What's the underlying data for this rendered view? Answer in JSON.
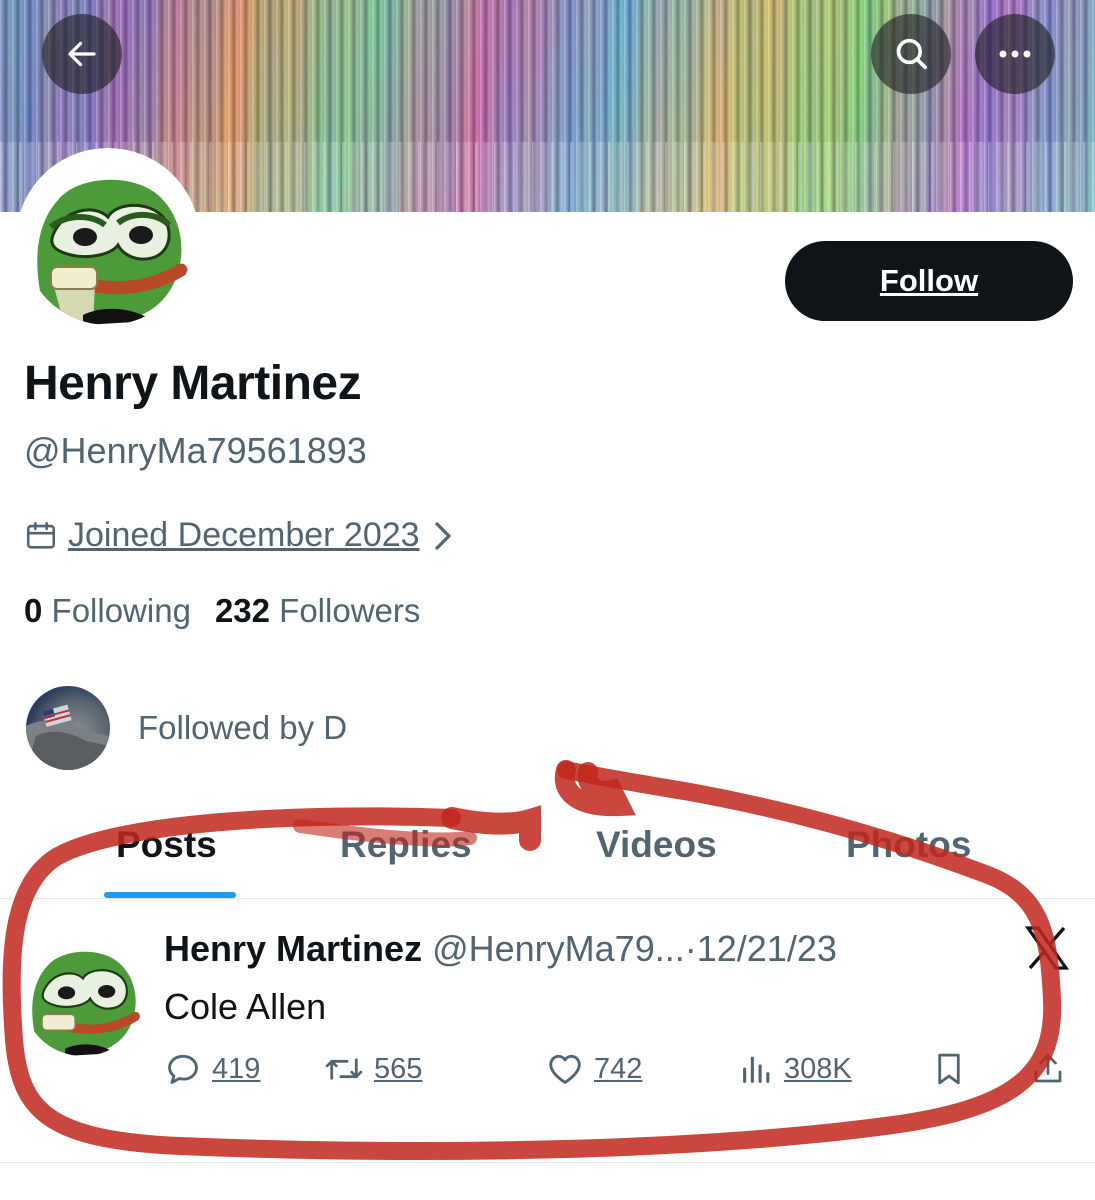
{
  "header": {
    "back_icon": "arrow-left-icon",
    "search_icon": "search-icon",
    "more_icon": "more-horizontal-icon"
  },
  "profile": {
    "display_name": "Henry Martinez",
    "handle": "@HenryMa79561893",
    "follow_label": "Follow",
    "joined": "Joined December 2023",
    "following_count": "0",
    "following_label": "Following",
    "followers_count": "232",
    "followers_label": "Followers",
    "followed_by": "Followed by D"
  },
  "tabs": [
    {
      "label": "Posts",
      "active": true
    },
    {
      "label": "Replies",
      "active": false
    },
    {
      "label": "Videos",
      "active": false
    },
    {
      "label": "Photos",
      "active": false
    }
  ],
  "post": {
    "author": "Henry Martinez",
    "handle": "@HenryMa79...",
    "separator": "·",
    "date": "12/21/23",
    "text": "Cole Allen",
    "replies": "419",
    "reposts": "565",
    "likes": "742",
    "views": "308K"
  },
  "colors": {
    "accent": "#1d9bf0",
    "text_primary": "#0f1419",
    "text_secondary": "#536471",
    "annotation": "#c0271c"
  }
}
